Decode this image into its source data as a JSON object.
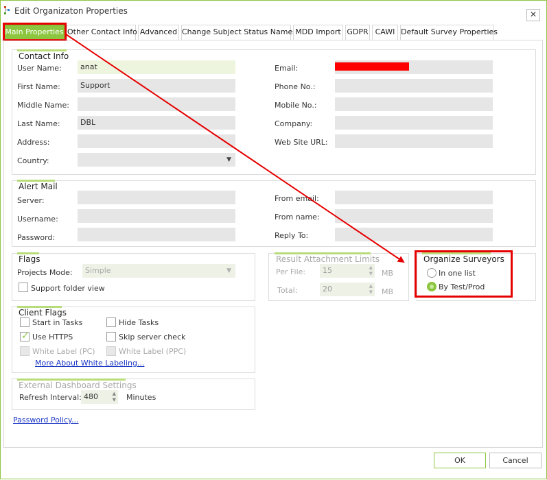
{
  "window": {
    "title": "Edit Organizaton Properties",
    "close_label": "✕",
    "accent_color": "#8cc63f",
    "highlight_color": "#e60000"
  },
  "tabs": [
    {
      "label": "Main Properties",
      "active": true
    },
    {
      "label": "Other Contact Info"
    },
    {
      "label": "Advanced"
    },
    {
      "label": "Change Subject Status Names"
    },
    {
      "label": "MDD Import"
    },
    {
      "label": "GDPR"
    },
    {
      "label": "CAWI"
    },
    {
      "label": "Default Survey Properties"
    }
  ],
  "contact_info": {
    "title": "Contact Info",
    "user_name_label": "User Name:",
    "user_name": "anat",
    "first_name_label": "First Name:",
    "first_name": "Support",
    "middle_name_label": "Middle Name:",
    "middle_name": "",
    "last_name_label": "Last Name:",
    "last_name": "DBL",
    "address_label": "Address:",
    "address": "",
    "country_label": "Country:",
    "country": "",
    "email_label": "Email:",
    "phone_label": "Phone No.:",
    "phone": "",
    "mobile_label": "Mobile No.:",
    "mobile": "",
    "company_label": "Company:",
    "company": "",
    "website_label": "Web Site URL:",
    "website": ""
  },
  "alert_mail": {
    "title": "Alert Mail",
    "server_label": "Server:",
    "username_label": "Username:",
    "password_label": "Password:",
    "from_email_label": "From email:",
    "from_name_label": "From name:",
    "reply_to_label": "Reply To:"
  },
  "flags": {
    "title": "Flags",
    "projects_mode_label": "Projects Mode:",
    "projects_mode_value": "Simple",
    "support_folder_view_label": "Support folder view"
  },
  "result_attachment_limits": {
    "title": "Result Attachment Limits",
    "per_file_label": "Per File:",
    "per_file_value": "15",
    "per_file_unit": "MB",
    "total_label": "Total:",
    "total_value": "20",
    "total_unit": "MB"
  },
  "organize_surveyors": {
    "title": "Organize Surveyors",
    "option_one_list": "In one list",
    "option_by_test_prod": "By Test/Prod",
    "selected": "By Test/Prod"
  },
  "client_flags": {
    "title": "Client Flags",
    "start_in_tasks": "Start in Tasks",
    "hide_tasks": "Hide Tasks",
    "use_https": "Use HTTPS",
    "skip_server_check": "Skip server check",
    "white_label_pc": "White Label (PC)",
    "white_label_ppc": "White Label (PPC)",
    "more_link": "More About White Labeling..."
  },
  "dashboard": {
    "title": "External Dashboard Settings",
    "refresh_label": "Refresh Interval:",
    "refresh_value": "480",
    "refresh_unit": "Minutes"
  },
  "password_policy_link": "Password Policy...",
  "buttons": {
    "ok": "OK",
    "cancel": "Cancel"
  }
}
